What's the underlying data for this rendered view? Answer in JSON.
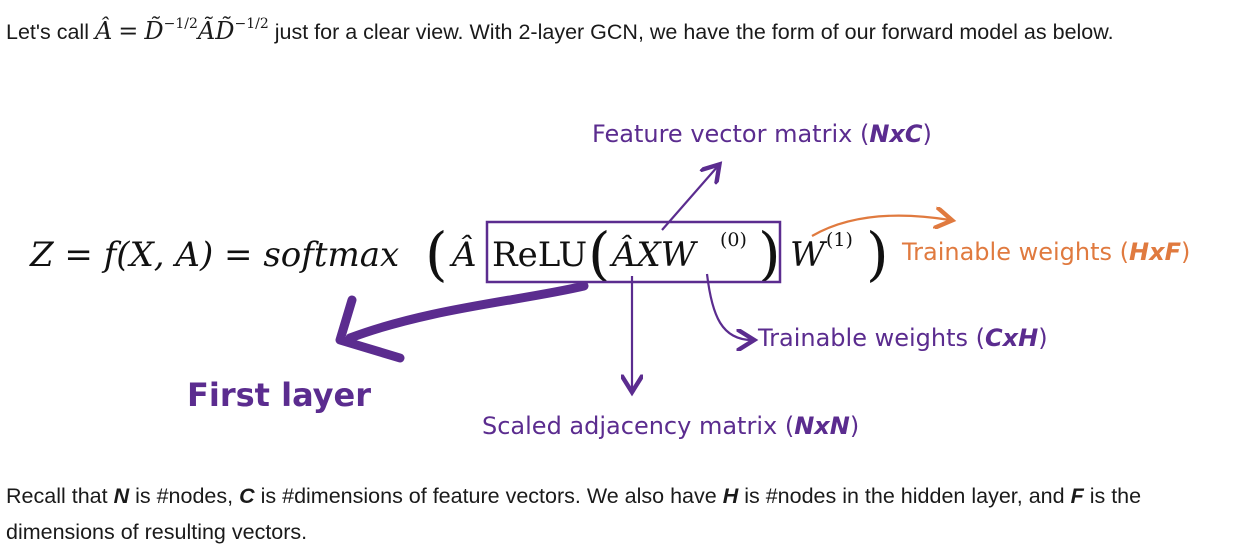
{
  "intro": {
    "lead": "Let's call",
    "after": "just for a clear view. With 2-layer GCN, we have the form of our forward model as below."
  },
  "formula": {
    "lhs": "Z = f(X, A) = softmax",
    "a_hat": "Â",
    "relu": "ReLU",
    "axw": "ÂXW",
    "sup0": "(0)",
    "w": "W",
    "sup1": "(1)"
  },
  "annotations": {
    "feature_vector": {
      "text": "Feature vector matrix (",
      "dims": "NxC",
      "close": ")"
    },
    "trainable_hf": {
      "text": "Trainable weights (",
      "dims": "HxF",
      "close": ")"
    },
    "trainable_ch": {
      "text": "Trainable weights (",
      "dims": "CxH",
      "close": ")"
    },
    "first_layer": "First layer",
    "scaled_adj": {
      "text": "Scaled adjacency matrix (",
      "dims": "NxN",
      "close": ")"
    }
  },
  "recall": {
    "p1": "Recall that",
    "n": "N",
    "p2": "is #nodes,",
    "c": "C",
    "p3": "is #dimensions of feature vectors. We also have",
    "h": "H",
    "p4": "is #nodes in the hidden layer, and",
    "f": "F",
    "p5": "is the dimensions of resulting vectors."
  },
  "colors": {
    "purple": "#5b2c8f",
    "orange": "#e07a3f",
    "text": "#1a1a1a"
  }
}
